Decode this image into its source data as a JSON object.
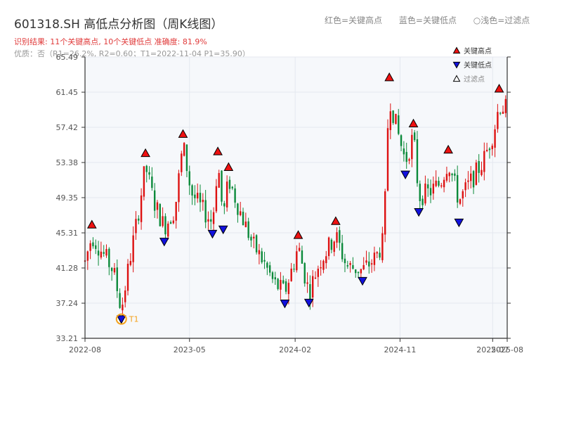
{
  "header": {
    "title": "601318.SH 高低点分析图（周K线图）",
    "subtitle": "识别结果: 11个关键高点, 10个关键低点  准确度: 81.9%",
    "quality": "优质：否（R1=26.2%, R2=0.60；T1=2022-11-04 P1=35.90）"
  },
  "top_legend": {
    "red": "红色=关键高点",
    "blue": "蓝色=关键低点",
    "light": "○浅色=过滤点"
  },
  "chart_data": {
    "type": "candlestick",
    "y_ticks": [
      "33.21",
      "37.24",
      "41.28",
      "45.31",
      "49.35",
      "53.38",
      "57.42",
      "61.45",
      "65.49"
    ],
    "ylim": [
      33.21,
      65.49
    ],
    "x_ticks": [
      "2022-08",
      "2023-05",
      "2024-02",
      "2024-11",
      "2025-07",
      "2025-08"
    ],
    "xlim": [
      "2022-08-01",
      "2025-08-08"
    ],
    "grid": true,
    "legend_position": "top-right",
    "legend": [
      {
        "label": "关键高点",
        "marker": "triangle-up",
        "color": "#ee1111"
      },
      {
        "label": "关键低点",
        "marker": "triangle-down",
        "color": "#1111dd"
      },
      {
        "label": "过滤点",
        "marker": "triangle-up-hollow",
        "color": "#ffffff"
      }
    ],
    "colors": {
      "up": "#dd1111",
      "down": "#0b8a3a",
      "high": "#ee1111",
      "low": "#1111dd",
      "annotation": "#f4a21c"
    },
    "key_highs": [
      {
        "date": "2022-08-19",
        "price": 45.6
      },
      {
        "date": "2023-01-06",
        "price": 53.8
      },
      {
        "date": "2023-04-14",
        "price": 56.0
      },
      {
        "date": "2023-07-14",
        "price": 54.0
      },
      {
        "date": "2023-08-11",
        "price": 52.2
      },
      {
        "date": "2024-02-09",
        "price": 44.4
      },
      {
        "date": "2024-05-17",
        "price": 46.0
      },
      {
        "date": "2024-10-04",
        "price": 62.5
      },
      {
        "date": "2024-12-06",
        "price": 57.2
      },
      {
        "date": "2025-03-07",
        "price": 54.2
      },
      {
        "date": "2025-07-18",
        "price": 61.2
      }
    ],
    "key_lows": [
      {
        "date": "2022-11-04",
        "price": 35.9
      },
      {
        "date": "2023-02-24",
        "price": 44.8
      },
      {
        "date": "2023-06-30",
        "price": 45.7
      },
      {
        "date": "2023-07-28",
        "price": 46.2
      },
      {
        "date": "2024-01-05",
        "price": 37.7
      },
      {
        "date": "2024-03-08",
        "price": 37.8
      },
      {
        "date": "2024-07-26",
        "price": 40.3
      },
      {
        "date": "2024-11-15",
        "price": 52.5
      },
      {
        "date": "2024-12-20",
        "price": 48.2
      },
      {
        "date": "2025-04-04",
        "price": 47.0
      }
    ],
    "t1": {
      "label": "T1",
      "date": "2022-11-04",
      "price": 35.9
    },
    "anchors": [
      [
        "2022-08-01",
        42.0
      ],
      [
        "2022-08-19",
        45.0
      ],
      [
        "2022-09-16",
        43.0
      ],
      [
        "2022-10-14",
        41.0
      ],
      [
        "2022-11-04",
        36.5
      ],
      [
        "2022-11-25",
        42.0
      ],
      [
        "2022-12-16",
        47.0
      ],
      [
        "2023-01-06",
        53.0
      ],
      [
        "2023-01-27",
        49.0
      ],
      [
        "2023-02-24",
        46.0
      ],
      [
        "2023-03-24",
        48.0
      ],
      [
        "2023-04-14",
        55.5
      ],
      [
        "2023-05-05",
        50.0
      ],
      [
        "2023-05-26",
        48.5
      ],
      [
        "2023-06-30",
        46.5
      ],
      [
        "2023-07-14",
        53.5
      ],
      [
        "2023-07-28",
        47.0
      ],
      [
        "2023-08-11",
        51.5
      ],
      [
        "2023-09-08",
        48.0
      ],
      [
        "2023-10-13",
        44.0
      ],
      [
        "2023-11-10",
        42.0
      ],
      [
        "2023-12-08",
        39.5
      ],
      [
        "2024-01-05",
        38.5
      ],
      [
        "2024-01-26",
        41.5
      ],
      [
        "2024-02-09",
        43.8
      ],
      [
        "2024-02-23",
        41.0
      ],
      [
        "2024-03-08",
        38.5
      ],
      [
        "2024-04-05",
        42.0
      ],
      [
        "2024-05-17",
        45.0
      ],
      [
        "2024-06-14",
        41.5
      ],
      [
        "2024-07-26",
        41.0
      ],
      [
        "2024-08-30",
        42.5
      ],
      [
        "2024-09-20",
        44.5
      ],
      [
        "2024-09-27",
        55.0
      ],
      [
        "2024-10-04",
        61.0
      ],
      [
        "2024-10-25",
        57.0
      ],
      [
        "2024-11-15",
        53.5
      ],
      [
        "2024-12-06",
        56.5
      ],
      [
        "2024-12-20",
        49.5
      ],
      [
        "2025-01-17",
        50.0
      ],
      [
        "2025-02-14",
        51.0
      ],
      [
        "2025-03-07",
        53.5
      ],
      [
        "2025-04-04",
        49.0
      ],
      [
        "2025-05-02",
        51.0
      ],
      [
        "2025-06-06",
        53.5
      ],
      [
        "2025-07-04",
        57.0
      ],
      [
        "2025-07-18",
        60.0
      ],
      [
        "2025-08-08",
        59.5
      ]
    ]
  }
}
